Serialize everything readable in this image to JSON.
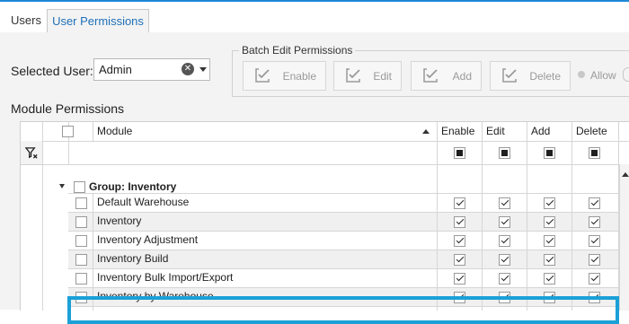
{
  "tabs": [
    "Users",
    "User Permissions"
  ],
  "selected_user": {
    "label": "Selected User:",
    "value": "Admin"
  },
  "batch_edit": {
    "title": "Batch Edit Permissions",
    "buttons": [
      "Enable",
      "Edit",
      "Add",
      "Delete"
    ],
    "allow_label": "Allow"
  },
  "module_permissions": {
    "title": "Module Permissions",
    "columns": [
      "Module",
      "Enable",
      "Edit",
      "Add",
      "Delete"
    ],
    "group_label": "Group: Inventory",
    "rows": [
      {
        "module": "Default Warehouse",
        "enable": true,
        "edit": true,
        "add": true,
        "delete": true
      },
      {
        "module": "Inventory",
        "enable": true,
        "edit": true,
        "add": true,
        "delete": true
      },
      {
        "module": "Inventory Adjustment",
        "enable": true,
        "edit": true,
        "add": true,
        "delete": true
      },
      {
        "module": "Inventory Build",
        "enable": true,
        "edit": true,
        "add": true,
        "delete": true
      },
      {
        "module": "Inventory Bulk Import/Export",
        "enable": true,
        "edit": true,
        "add": true,
        "delete": true,
        "highlighted": true
      },
      {
        "module": "Inventory by Warehouse",
        "enable": true,
        "edit": true,
        "add": true,
        "delete": true
      }
    ]
  },
  "colors": {
    "accent": "#1e88d6",
    "highlight": "#1ba0d7",
    "tab_active_text": "#1e6fb8"
  }
}
